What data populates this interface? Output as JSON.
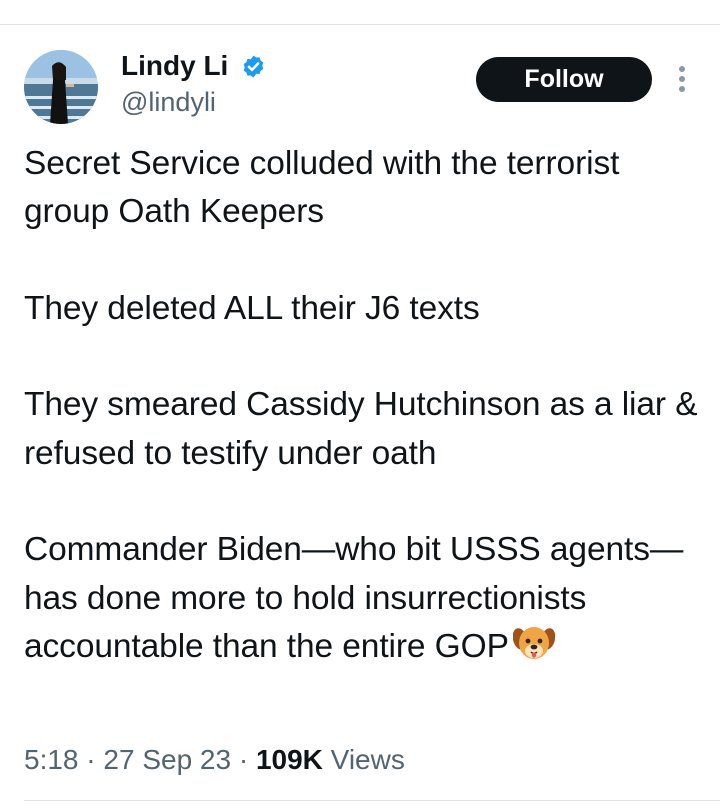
{
  "author": {
    "name": "Lindy Li",
    "handle": "@lindyli",
    "verified": true
  },
  "actions": {
    "follow_label": "Follow"
  },
  "icons": {
    "verified": "verified-badge-icon",
    "more": "more-vertical-icon",
    "emoji": "dog-face-emoji"
  },
  "tweet": {
    "paragraphs": [
      "Secret Service colluded with the terrorist group Oath Keepers",
      "They deleted ALL their J6 texts",
      "They smeared Cassidy Hutchinson as a liar & refused to testify under oath",
      "Commander Biden—who bit USSS agents—has done more to hold insurrectionists accountable than the entire GOP"
    ]
  },
  "meta": {
    "time": "5:18",
    "separator": " · ",
    "date": "27 Sep 23",
    "views_count": "109K",
    "views_label": " Views"
  },
  "colors": {
    "text": "#0f1419",
    "secondary": "#536471",
    "verified": "#1d9bf0",
    "follow_bg": "#0f1419"
  }
}
